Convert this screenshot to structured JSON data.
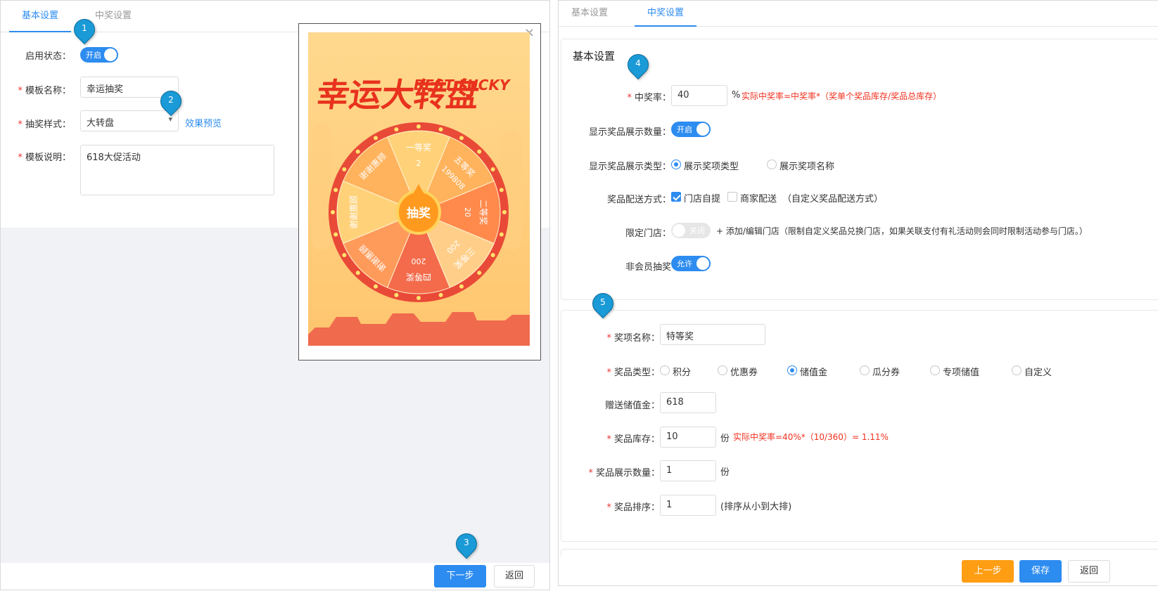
{
  "left": {
    "tabs": [
      "基本设置",
      "中奖设置"
    ],
    "enable_label": "启用状态：",
    "enable_toggle": "开启",
    "name_label": "模板名称：",
    "name_value": "幸运抽奖",
    "style_label": "抽奖样式：",
    "style_value": "大转盘",
    "preview_link": "效果预览",
    "desc_label": "模板说明：",
    "desc_value": "618大促活动",
    "next_button": "下一步",
    "back_button": "返回",
    "preview": {
      "title_main": "幸运大转盘",
      "title_sub": "BEST LUCKY",
      "center_button": "抽奖",
      "close_icon": "×",
      "segments": [
        "一等奖",
        "2",
        "五等奖",
        "199808",
        "二等奖",
        "20",
        "三等奖",
        "200",
        "四等奖",
        "200",
        "谢谢惠顾",
        "谢谢惠顾",
        "谢谢惠顾"
      ]
    }
  },
  "right": {
    "tabs": [
      "基本设置",
      "中奖设置"
    ],
    "section1_title": "基本设置",
    "win_rate_label": "中奖率：",
    "win_rate_value": "40",
    "win_rate_unit": "%",
    "win_rate_hint": "实际中奖率=中奖率*（奖单个奖品库存/奖品总库存）",
    "show_count_label": "显示奖品展示数量：",
    "show_count_toggle": "开启",
    "show_type_label": "显示奖品展示类型：",
    "show_type_options": [
      "展示奖项类型",
      "展示奖项名称"
    ],
    "delivery_label": "奖品配送方式：",
    "delivery_options": [
      "门店自提",
      "商家配送"
    ],
    "delivery_hint": "（自定义奖品配送方式）",
    "store_label": "限定门店：",
    "store_toggle": "关闭",
    "store_hint": "+ 添加/编辑门店（限制自定义奖品兑换门店，如果关联支付有礼活动则会同时限制活动参与门店。）",
    "member_label": "非会员抽奖",
    "member_toggle": "允许",
    "prize_name_label": "奖项名称：",
    "prize_name_value": "特等奖",
    "prize_type_label": "奖品类型：",
    "prize_type_options": [
      "积分",
      "优惠券",
      "储值金",
      "瓜分券",
      "专项储值",
      "自定义"
    ],
    "gift_label": "赠送储值金：",
    "gift_value": "618",
    "stock_label": "奖品库存：",
    "stock_value": "10",
    "stock_unit": "份",
    "stock_hint": "实际中奖率=40%*（10/360）= 1.11%",
    "display_count_label": "奖品展示数量：",
    "display_count_value": "1",
    "display_count_unit": "份",
    "sort_label": "奖品排序：",
    "sort_value": "1",
    "sort_hint": "(排序从小到大排)",
    "prev_button": "上一步",
    "save_button": "保存",
    "back_button": "返回"
  },
  "markers": [
    "1",
    "2",
    "3",
    "4",
    "5"
  ],
  "colors": {
    "accent": "#2d8cf0",
    "orange": "#ff9d13",
    "red_hint": "#f0311f",
    "marker": "#1a9ad6"
  }
}
